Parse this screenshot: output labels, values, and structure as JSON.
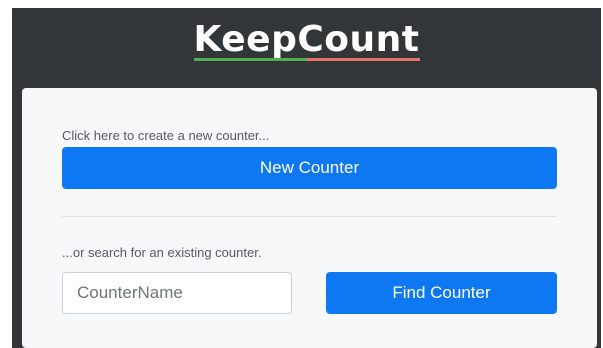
{
  "app": {
    "title": "KeepCount",
    "title_underline_colors": [
      "#4caf50",
      "#e57368"
    ]
  },
  "card": {
    "create_hint": "Click here to create a new counter...",
    "new_counter_label": "New Counter",
    "search_hint": "...or search for an existing counter.",
    "search_input": {
      "placeholder": "CounterName",
      "value": ""
    },
    "find_counter_label": "Find Counter"
  },
  "colors": {
    "header_background": "#333639",
    "card_background": "#f7f8fa",
    "primary_button": "#0d78f2"
  }
}
